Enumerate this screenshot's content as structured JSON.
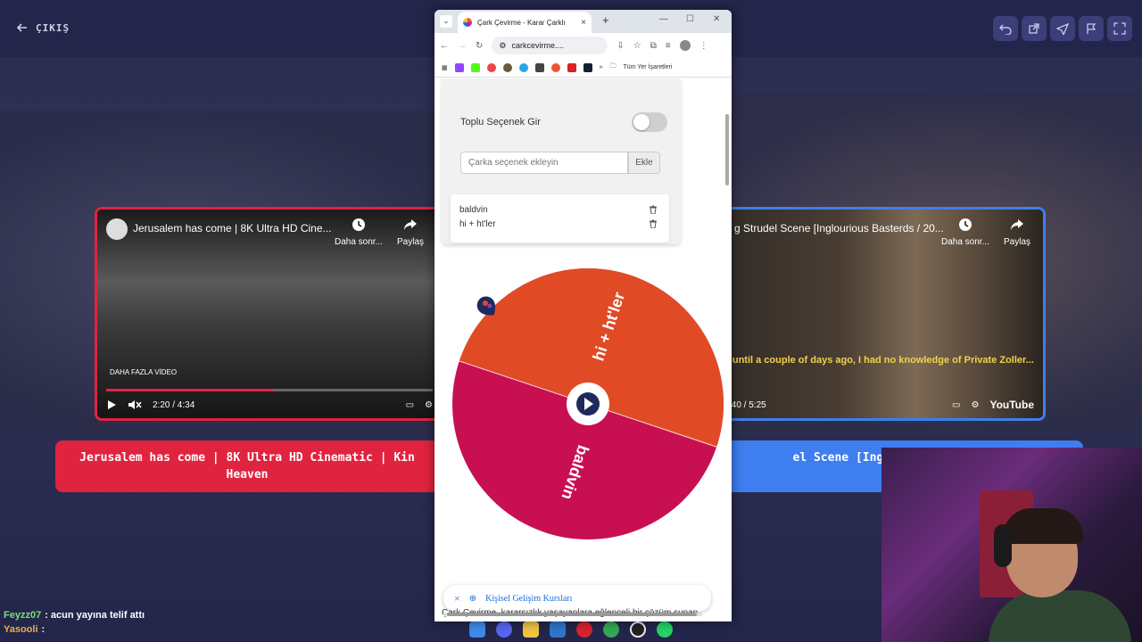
{
  "stage": {
    "exit_label": "ÇIKIŞ",
    "toolbar_icons": [
      "undo-icon",
      "external-link-icon",
      "send-icon",
      "flag-icon",
      "fullscreen-icon"
    ]
  },
  "video_left": {
    "title": "Jerusalem has come | 8K Ultra HD Cine...",
    "watch_later": "Daha sonr...",
    "share": "Paylaş",
    "more_videos": "DAHA FAZLA VİDEO",
    "time": "2:20 / 4:34",
    "progress": 0.51,
    "pill_text": "Jerusalem has come | 8K Ultra HD Cinematic | Kin Heaven"
  },
  "video_right": {
    "title": "g Strudel Scene [Inglourious Basterds / 20...",
    "watch_later": "Daha sonr...",
    "share": "Paylaş",
    "subtitle": "Up until a couple of days ago, I had no knowledge of Private Zoller...",
    "time": ":40 / 5:25",
    "brand": "YouTube",
    "pill_text": "el Scene [Inglourious Clip HD"
  },
  "chat": [
    {
      "user": "Feyzz07",
      "message": ": acun yayına telif attı"
    },
    {
      "user": "Yasooli",
      "message": ":"
    }
  ],
  "browser": {
    "tab_title": "Çark Çevirme - Karar Çarklı",
    "url": "carkcevirme....",
    "bookmarks_folder": "Tüm Yer İşaretleri",
    "bulk_label": "Toplu Seçenek Gir",
    "bulk_enabled": false,
    "input_placeholder": "Çarka seçenek ekleyin",
    "add_button": "Ekle",
    "options": [
      "baldvin",
      "hi + ht'ler"
    ],
    "wheel_segments": [
      {
        "label": "hi + ht'ler",
        "color": "#e04a25"
      },
      {
        "label": "baldvin",
        "color": "#c80f52"
      }
    ],
    "notice_text": "Kişisel Gelişim Kursları",
    "description": "Çark Çevirme, kararsızlık yaşayanlara eğlenceli bir çözüm sunan"
  },
  "colors": {
    "accent_red": "#e0233f",
    "accent_blue": "#3e7ef0",
    "wheel_orange": "#e04a25",
    "wheel_magenta": "#c80f52"
  }
}
